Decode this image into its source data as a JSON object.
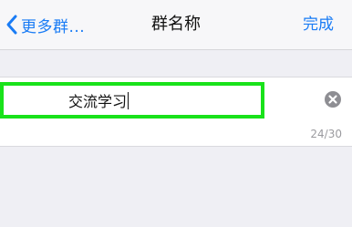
{
  "nav": {
    "back_label": "更多群...",
    "title": "群名称",
    "done_label": "完成"
  },
  "group_name": {
    "value": "交流学习",
    "counter": "24/30"
  },
  "colors": {
    "accent": "#1a7cf5",
    "highlight": "#19e21a",
    "background": "#efeff4"
  },
  "icons": {
    "back": "chevron-left-icon",
    "clear": "clear-circle-icon"
  }
}
